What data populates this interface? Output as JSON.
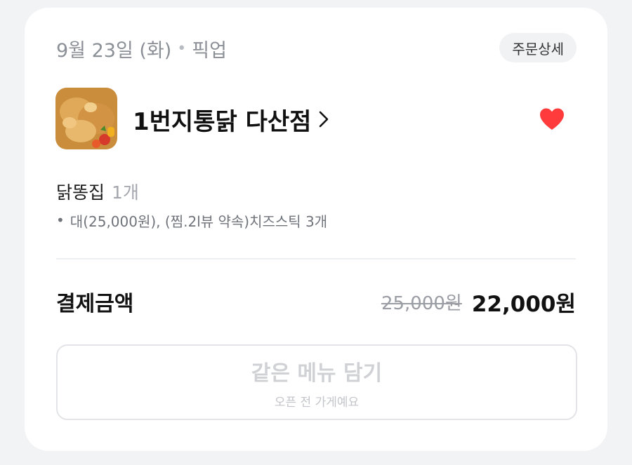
{
  "order": {
    "date": "9월 23일 (화)",
    "separator": "•",
    "type": "픽업",
    "detail_button": "주문상세"
  },
  "store": {
    "name": "1번지통닭 다산점",
    "thumbnail_icon": "fried-chicken-photo",
    "favorite_icon": "heart-icon",
    "favorite_color": "#ff3b3b"
  },
  "menu": {
    "name": "닭똥집",
    "quantity": "1개",
    "bullet": "•",
    "options": "대(25,000원), (찜.2l뷰 약속)치즈스틱 3개"
  },
  "payment": {
    "label": "결제금액",
    "original_price": "25,000원",
    "final_price": "22,000원"
  },
  "reorder": {
    "label": "같은 메뉴 담기",
    "sub_label": "오픈 전 가게예요"
  }
}
